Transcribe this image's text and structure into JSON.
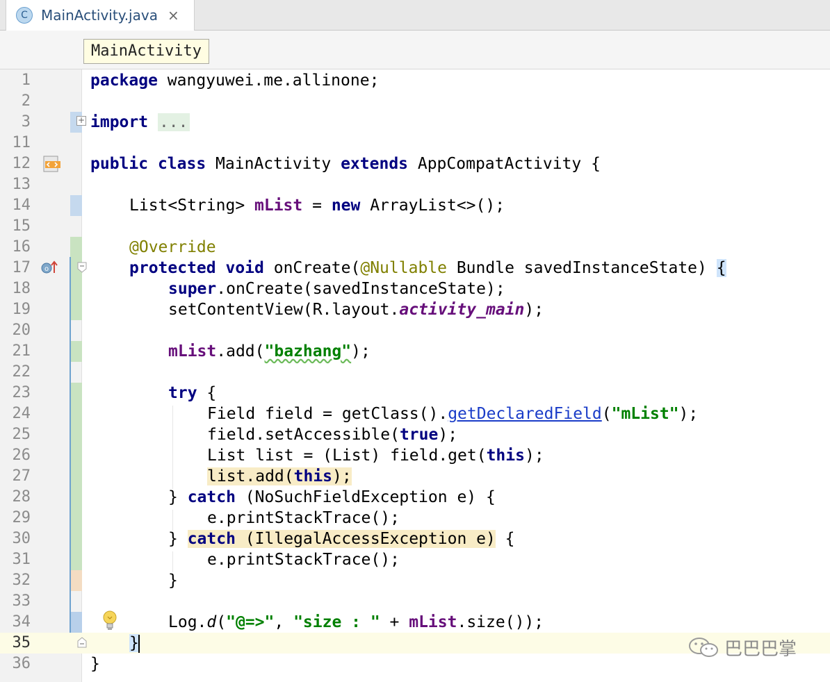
{
  "tab": {
    "icon_letter": "C",
    "label": "MainActivity.java",
    "close": "×"
  },
  "breadcrumb": {
    "label": "MainActivity"
  },
  "lines": [
    {
      "num": "1"
    },
    {
      "num": "2"
    },
    {
      "num": "3"
    },
    {
      "num": "11"
    },
    {
      "num": "12"
    },
    {
      "num": "13"
    },
    {
      "num": "14"
    },
    {
      "num": "15"
    },
    {
      "num": "16"
    },
    {
      "num": "17"
    },
    {
      "num": "18"
    },
    {
      "num": "19"
    },
    {
      "num": "20"
    },
    {
      "num": "21"
    },
    {
      "num": "22"
    },
    {
      "num": "23"
    },
    {
      "num": "24"
    },
    {
      "num": "25"
    },
    {
      "num": "26"
    },
    {
      "num": "27"
    },
    {
      "num": "28"
    },
    {
      "num": "29"
    },
    {
      "num": "30"
    },
    {
      "num": "31"
    },
    {
      "num": "32"
    },
    {
      "num": "33"
    },
    {
      "num": "34"
    },
    {
      "num": "35"
    },
    {
      "num": "36"
    }
  ],
  "code": {
    "l1_kw": "package",
    "l1_rest": " wangyuwei.me.allinone;",
    "l3_kw": "import",
    "l3_fold": "...",
    "l12_kw1": "public",
    "l12_kw2": "class",
    "l12_name": " MainActivity ",
    "l12_kw3": "extends",
    "l12_rest": " AppCompatActivity {",
    "l14_type": "List<String> ",
    "l14_fld": "mList",
    "l14_eq": " = ",
    "l14_kw": "new",
    "l14_rest": " ArrayList<>();",
    "l16_ann": "@Override",
    "l17_kw1": "protected",
    "l17_kw2": "void",
    "l17_name": " onCreate(",
    "l17_ann": "@Nullable",
    "l17_rest": " Bundle savedInstanceState) ",
    "l17_brace": "{",
    "l18_kw": "super",
    "l18_rest": ".onCreate(savedInstanceState);",
    "l19_pre": "setContentView(R.layout.",
    "l19_fld": "activity_main",
    "l19_post": ");",
    "l21_fld": "mList",
    "l21_mid": ".add(",
    "l21_str": "\"bazhang\"",
    "l21_post": ");",
    "l23_kw": "try",
    "l23_rest": " {",
    "l24_pre": "Field field = getClass().",
    "l24_link": "getDeclaredField",
    "l24_open": "(",
    "l24_str": "\"mList\"",
    "l24_post": ");",
    "l25_pre": "field.setAccessible(",
    "l25_kw": "true",
    "l25_post": ");",
    "l26_pre": "List list = (List) field.get(",
    "l26_kw": "this",
    "l26_post": ");",
    "l27_hl": "list.add(",
    "l27_kw": "this",
    "l27_post": ");",
    "l28_pre": "} ",
    "l28_kw": "catch",
    "l28_rest": " (NoSuchFieldException e) {",
    "l29_text": "e.printStackTrace();",
    "l30_pre": "} ",
    "l30_kw": "catch",
    "l30_rest": " (IllegalAccessException e)",
    "l30_post": " {",
    "l31_text": "e.printStackTrace();",
    "l32_text": "}",
    "l34_pre": "Log.",
    "l34_ital": "d",
    "l34_open": "(",
    "l34_str1": "\"@=>\"",
    "l34_comma": ", ",
    "l34_str2": "\"size : \"",
    "l34_plus": " + ",
    "l34_fld": "mList",
    "l34_post": ".size());",
    "l35_text": "}",
    "l36_text": "}"
  },
  "watermark": {
    "text": "巴巴巴掌"
  },
  "colors": {
    "keyword": "#000080",
    "field": "#660e7a",
    "string": "#008000",
    "annotation": "#808000",
    "link": "#1a3cc8"
  }
}
